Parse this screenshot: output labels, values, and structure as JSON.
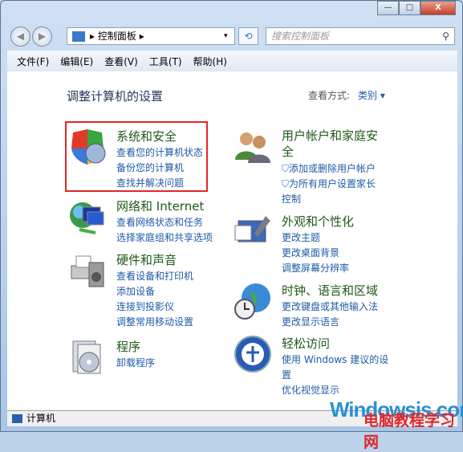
{
  "window": {
    "buttons": {
      "minimize": "—",
      "maximize": "□",
      "close": "X"
    }
  },
  "address": {
    "path": "控制面板",
    "separator": "▸",
    "dropdown": "▾",
    "refresh": "⟲"
  },
  "search": {
    "placeholder": "搜索控制面板",
    "icon": "⚲"
  },
  "menu": [
    "文件(F)",
    "编辑(E)",
    "查看(V)",
    "工具(T)",
    "帮助(H)"
  ],
  "heading": "调整计算机的设置",
  "view_by": {
    "label": "查看方式:",
    "value": "类别 ▾"
  },
  "categories": [
    {
      "title": "系统和安全",
      "links": [
        "查看您的计算机状态",
        "备份您的计算机",
        "查找并解决问题"
      ],
      "icon": "shield-icon"
    },
    {
      "title": "网络和 Internet",
      "links": [
        "查看网络状态和任务",
        "选择家庭组和共享选项"
      ],
      "icon": "network-icon"
    },
    {
      "title": "硬件和声音",
      "links": [
        "查看设备和打印机",
        "添加设备",
        "连接到投影仪",
        "调整常用移动设置"
      ],
      "icon": "printer-icon"
    },
    {
      "title": "程序",
      "links": [
        "卸载程序"
      ],
      "icon": "programs-icon"
    },
    {
      "title": "用户帐户和家庭安全",
      "links": [
        "添加或删除用户帐户",
        "为所有用户设置家长控制"
      ],
      "icon": "users-icon"
    },
    {
      "title": "外观和个性化",
      "links": [
        "更改主题",
        "更改桌面背景",
        "调整屏幕分辨率"
      ],
      "icon": "appearance-icon"
    },
    {
      "title": "时钟、语言和区域",
      "links": [
        "更改键盘或其他输入法",
        "更改显示语言"
      ],
      "icon": "clock-globe-icon"
    },
    {
      "title": "轻松访问",
      "links": [
        "使用 Windows 建议的设置",
        "优化视觉显示"
      ],
      "icon": "ease-of-access-icon"
    }
  ],
  "status": "计算机",
  "watermark": {
    "line1": "Windowsis.com",
    "line2": "电脑教程学习网"
  }
}
